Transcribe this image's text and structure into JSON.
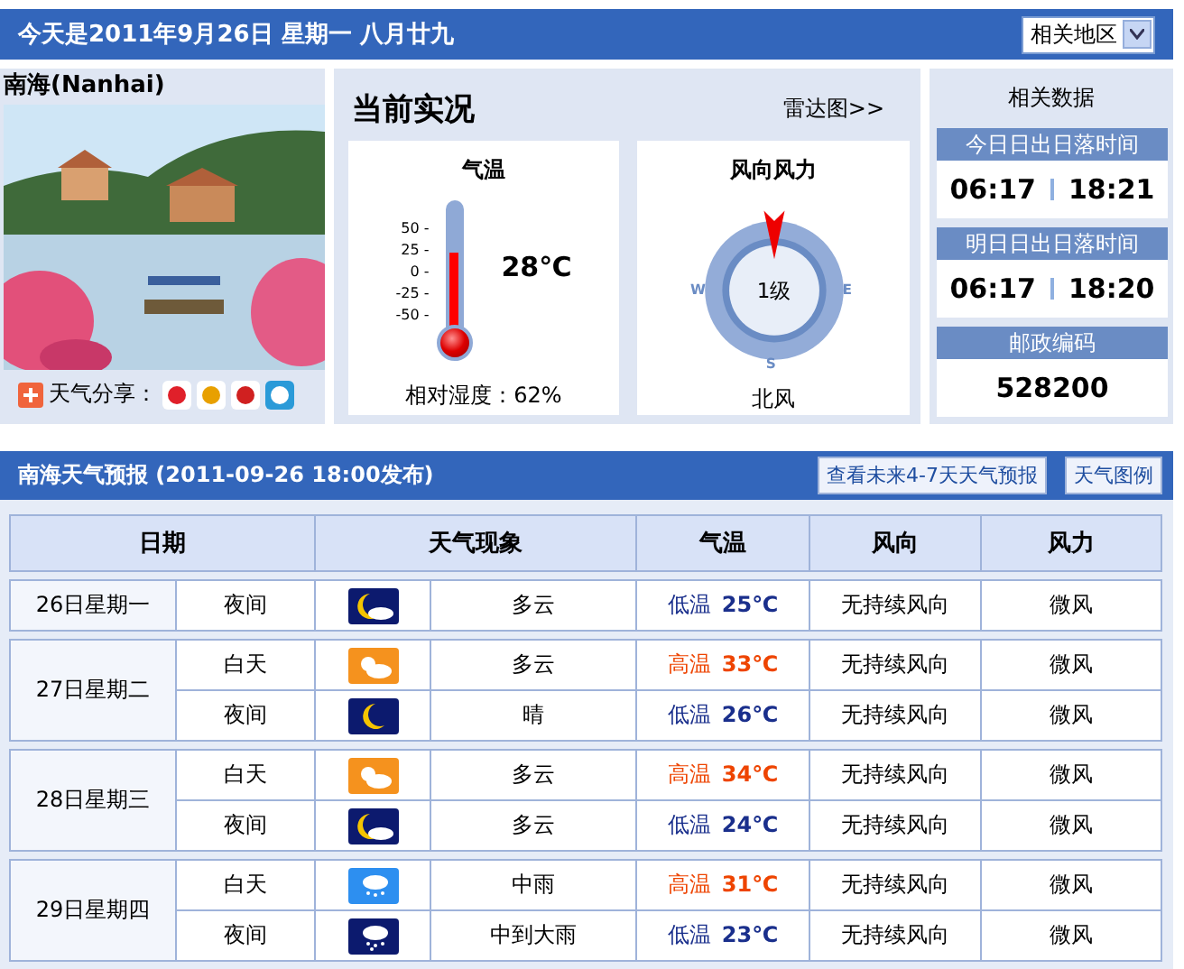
{
  "top_bar": {
    "date_text": "今天是2011年9月26日  星期一  八月廿九",
    "region_select": "相关地区"
  },
  "city": {
    "name": "南海(Nanhai)",
    "share_label": "天气分享："
  },
  "current": {
    "title": "当前实况",
    "radar_link": "雷达图>>",
    "temperature": {
      "title": "气温",
      "scale": [
        "50 -",
        "25 -",
        "0 -",
        "-25 -",
        "-50 -"
      ],
      "level": 0.6,
      "reading": "28℃",
      "humidity": "相对湿度：62%"
    },
    "wind": {
      "title": "风向风力",
      "compass_labels": [
        "W",
        "E",
        "S"
      ],
      "force": "1级",
      "direction": "北风"
    }
  },
  "related": {
    "title": "相关数据",
    "cards": [
      {
        "header": "今日日出日落时间",
        "values": [
          "06:17",
          "18:21"
        ]
      },
      {
        "header": "明日日出日落时间",
        "values": [
          "06:17",
          "18:20"
        ]
      },
      {
        "header": "邮政编码",
        "values": [
          "528200"
        ]
      }
    ]
  },
  "forecast": {
    "title": "南海天气预报  (2011-09-26  18:00发布)",
    "buttons": [
      "查看未来4-7天天气预报",
      "天气图例"
    ],
    "columns": [
      "日期",
      "天气现象",
      "气温",
      "风向",
      "风力"
    ],
    "days": [
      {
        "date": "26日星期一",
        "periods": [
          {
            "period": "夜间",
            "kind": "cloudy-night",
            "weather": "多云",
            "temperature": {
              "kind": "low",
              "label": "低温",
              "value": "25℃"
            },
            "wind_dir": "无持续风向",
            "wind_force": "微风"
          }
        ]
      },
      {
        "date": "27日星期二",
        "periods": [
          {
            "period": "白天",
            "kind": "cloudy-day",
            "weather": "多云",
            "temperature": {
              "kind": "high",
              "label": "高温",
              "value": "33℃"
            },
            "wind_dir": "无持续风向",
            "wind_force": "微风"
          },
          {
            "period": "夜间",
            "kind": "clear-night",
            "weather": "晴",
            "temperature": {
              "kind": "low",
              "label": "低温",
              "value": "26℃"
            },
            "wind_dir": "无持续风向",
            "wind_force": "微风"
          }
        ]
      },
      {
        "date": "28日星期三",
        "periods": [
          {
            "period": "白天",
            "kind": "cloudy-day",
            "weather": "多云",
            "temperature": {
              "kind": "high",
              "label": "高温",
              "value": "34℃"
            },
            "wind_dir": "无持续风向",
            "wind_force": "微风"
          },
          {
            "period": "夜间",
            "kind": "cloudy-night",
            "weather": "多云",
            "temperature": {
              "kind": "low",
              "label": "低温",
              "value": "24℃"
            },
            "wind_dir": "无持续风向",
            "wind_force": "微风"
          }
        ]
      },
      {
        "date": "29日星期四",
        "periods": [
          {
            "period": "白天",
            "kind": "rain-day",
            "weather": "中雨",
            "temperature": {
              "kind": "high",
              "label": "高温",
              "value": "31℃"
            },
            "wind_dir": "无持续风向",
            "wind_force": "微风"
          },
          {
            "period": "夜间",
            "kind": "rain-night",
            "weather": "中到大雨",
            "temperature": {
              "kind": "low",
              "label": "低温",
              "value": "23℃"
            },
            "wind_dir": "无持续风向",
            "wind_force": "微风"
          }
        ]
      }
    ]
  }
}
